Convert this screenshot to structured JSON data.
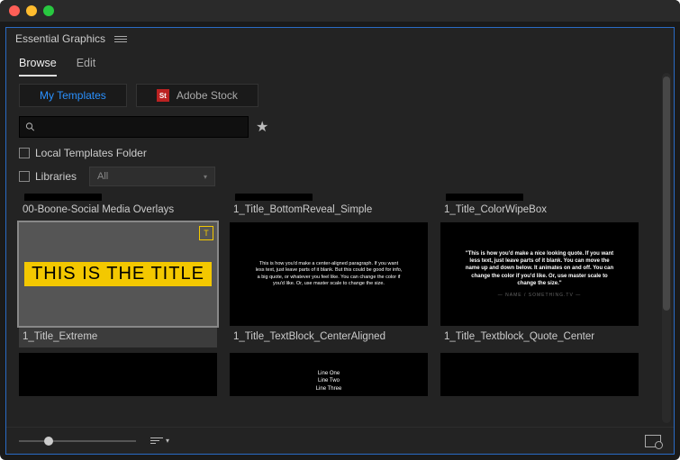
{
  "panel_title": "Essential Graphics",
  "tabs": {
    "browse": "Browse",
    "edit": "Edit"
  },
  "sources": {
    "my_templates": "My Templates",
    "adobe_stock": "Adobe Stock",
    "stock_icon": "St"
  },
  "search": {
    "placeholder": ""
  },
  "options": {
    "local_folder": "Local Templates Folder",
    "libraries": "Libraries",
    "libraries_filter": "All"
  },
  "folders": [
    {
      "label": "00-Boone-Social Media Overlays"
    },
    {
      "label": "1_Title_BottomReveal_Simple"
    },
    {
      "label": "1_Title_ColorWipeBox"
    }
  ],
  "templates": [
    {
      "label": "1_Title_Extreme",
      "selected": true,
      "title_text": "THIS IS THE TITLE",
      "badge": "T"
    },
    {
      "label": "1_Title_TextBlock_CenterAligned",
      "para": "This is how you'd make a center-aligned paragraph. If you want less text, just leave parts of it blank. But this could be good for info, a big quote, or whatever you feel like. You can change the color if you'd like. Or, use master scale to change the size."
    },
    {
      "label": "1_Title_Textblock_Quote_Center",
      "quote": "\"This is how you'd make a nice looking quote. If you want less text, just leave parts of it blank. You can move the name up and down below. It animates on and off. You can change the color if you'd like. Or, use master scale to change the size.\"",
      "attribution": "— NAME / SOMETHING.TV —"
    }
  ],
  "templates_row2": [
    {
      "label": "",
      "blank": true
    },
    {
      "label": "",
      "lines": [
        "Line One",
        "Line Two",
        "Line Three"
      ]
    },
    {
      "label": "",
      "blank": true
    }
  ]
}
